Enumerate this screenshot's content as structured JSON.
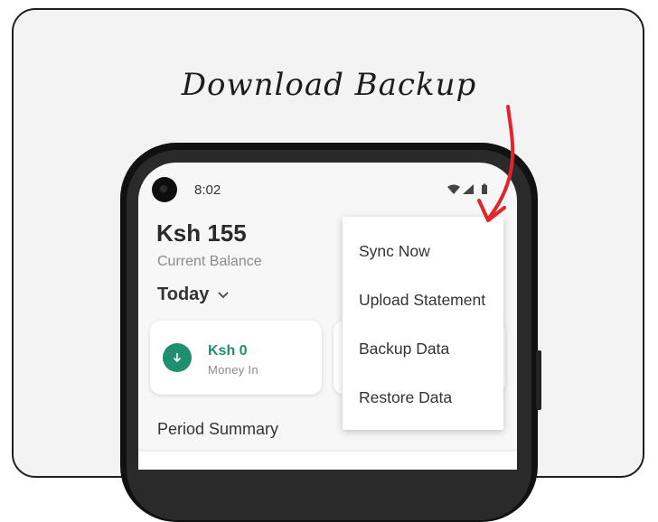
{
  "caption": "Download Backup",
  "status_bar": {
    "time": "8:02",
    "icons": [
      "wifi-icon",
      "signal-icon",
      "battery-icon"
    ]
  },
  "balance": {
    "amount": "Ksh 155",
    "label": "Current Balance"
  },
  "period_selector": {
    "label": "Today"
  },
  "money_in": {
    "amount": "Ksh 0",
    "label": "Money In"
  },
  "section_title": "Period Summary",
  "menu": {
    "items": [
      {
        "label": "Sync Now"
      },
      {
        "label": "Upload Statement"
      },
      {
        "label": "Backup Data"
      },
      {
        "label": "Restore Data"
      }
    ]
  },
  "colors": {
    "accent": "#1f8f6f",
    "arrow": "#e0262d"
  }
}
